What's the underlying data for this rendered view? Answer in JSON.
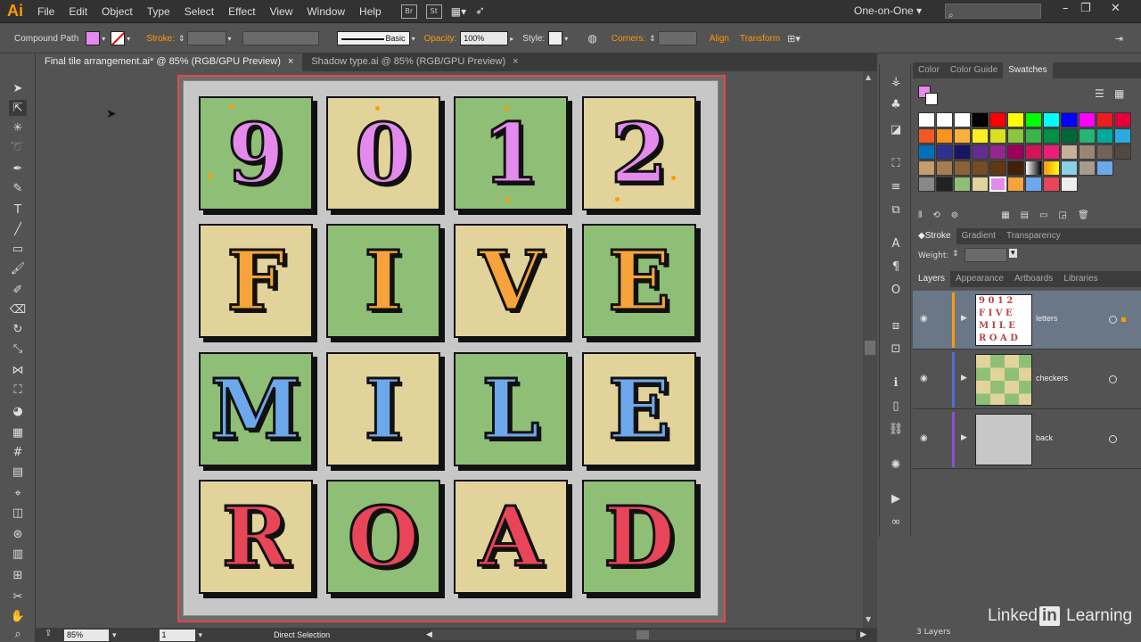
{
  "app": {
    "logo": "Ai"
  },
  "menu": [
    "File",
    "Edit",
    "Object",
    "Type",
    "Select",
    "Effect",
    "View",
    "Window",
    "Help"
  ],
  "menu_icons": {
    "bridge": "Br",
    "stock": "St"
  },
  "workspace": "One-on-One",
  "control": {
    "selection": "Compound Path",
    "stroke_label": "Stroke:",
    "stroke_style": "Basic",
    "opacity_label": "Opacity:",
    "opacity_value": "100%",
    "style_label": "Style:",
    "corners_label": "Corners:",
    "align_label": "Align",
    "transform_label": "Transform"
  },
  "tabs": [
    {
      "label": "Final tile arrangement.ai* @ 85% (RGB/GPU Preview)",
      "close": "×"
    },
    {
      "label": "Shadow type.ai @ 85% (RGB/GPU Preview)",
      "close": "×"
    }
  ],
  "colors": {
    "pink": "#e48aec",
    "orange": "#f5a33a",
    "blue": "#6ea8ec",
    "red": "#e94558",
    "green_tile": "#8fbf76",
    "cream_tile": "#e2d39a",
    "selection": "#ff9a00"
  },
  "tiles": [
    [
      "9",
      "0",
      "1",
      "2"
    ],
    [
      "F",
      "I",
      "V",
      "E"
    ],
    [
      "M",
      "I",
      "L",
      "E"
    ],
    [
      "R",
      "O",
      "A",
      "D"
    ]
  ],
  "status": {
    "zoom": "85%",
    "page": "1",
    "tool": "Direct Selection"
  },
  "panels": {
    "top_tabs": [
      "Color",
      "Color Guide",
      "Swatches"
    ],
    "stroke_tabs": [
      "Stroke",
      "Gradient",
      "Transparency"
    ],
    "weight_label": "Weight:",
    "layer_tabs": [
      "Layers",
      "Appearance",
      "Artboards",
      "Libraries"
    ],
    "layers": [
      {
        "name": "letters",
        "color": "#ff9a00"
      },
      {
        "name": "checkers",
        "color": "#4f6fd8"
      },
      {
        "name": "back",
        "color": "#8a4fd8"
      }
    ],
    "layer_count": "3 Layers"
  },
  "watermark": {
    "text1": "Linked",
    "box": "in",
    "text2": "Learning"
  }
}
